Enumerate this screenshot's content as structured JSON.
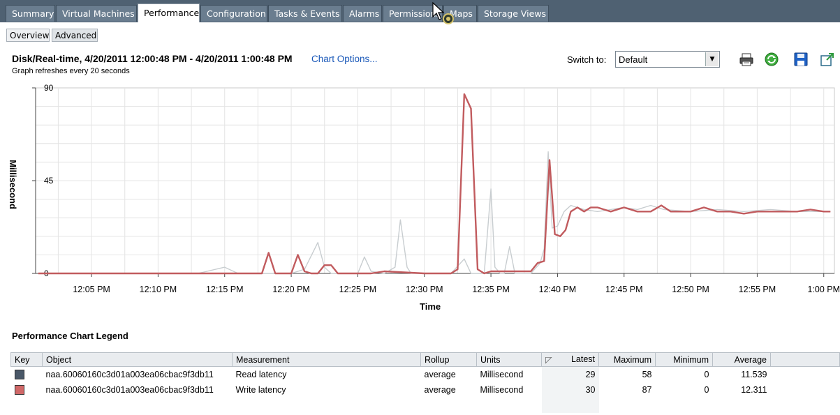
{
  "tabs": [
    {
      "label": "Summary",
      "active": false
    },
    {
      "label": "Virtual Machines",
      "active": false
    },
    {
      "label": "Performance",
      "active": true
    },
    {
      "label": "Configuration",
      "active": false
    },
    {
      "label": "Tasks & Events",
      "active": false
    },
    {
      "label": "Alarms",
      "active": false
    },
    {
      "label": "Permissions",
      "active": false
    },
    {
      "label": "Maps",
      "active": false
    },
    {
      "label": "Storage Views",
      "active": false
    }
  ],
  "subtabs": [
    {
      "label": "Overview",
      "active": false
    },
    {
      "label": "Advanced",
      "active": true
    }
  ],
  "header": {
    "title": "Disk/Real-time, 4/20/2011 12:00:48 PM - 4/20/2011 1:00:48 PM",
    "chart_options": "Chart Options...",
    "refresh_note": "Graph refreshes every 20 seconds",
    "switch_to_label": "Switch to:",
    "switch_to_value": "Default"
  },
  "toolbar": {
    "icons": [
      "print-icon",
      "refresh-icon",
      "save-icon",
      "popout-icon"
    ]
  },
  "colors": {
    "read": "#c8cdd0",
    "write": "#c15b5e",
    "read_swatch": "#4a5868",
    "write_swatch": "#d06868"
  },
  "chart_data": {
    "type": "line",
    "xlabel": "Time",
    "ylabel": "Millisecond",
    "ylim": [
      0,
      90
    ],
    "yticks": [
      0,
      45,
      90
    ],
    "xticks": [
      "12:05 PM",
      "12:10 PM",
      "12:15 PM",
      "12:20 PM",
      "12:25 PM",
      "12:30 PM",
      "12:35 PM",
      "12:40 PM",
      "12:45 PM",
      "12:50 PM",
      "12:55 PM",
      "1:00 PM"
    ],
    "xlim_minutes_after_noon": [
      0.8,
      60.8
    ],
    "grid": true,
    "series": [
      {
        "name": "Read latency",
        "points": [
          [
            1,
            0
          ],
          [
            10,
            0
          ],
          [
            13,
            0
          ],
          [
            15,
            3
          ],
          [
            16,
            0
          ],
          [
            20,
            0
          ],
          [
            21,
            2
          ],
          [
            22,
            15
          ],
          [
            22.5,
            3
          ],
          [
            23,
            0
          ],
          [
            25,
            0
          ],
          [
            25.5,
            8
          ],
          [
            26,
            1
          ],
          [
            27,
            0
          ],
          [
            27.8,
            3
          ],
          [
            28.2,
            26
          ],
          [
            28.7,
            3
          ],
          [
            29,
            0
          ],
          [
            32,
            0
          ],
          [
            33,
            7
          ],
          [
            33.5,
            0
          ],
          [
            34.5,
            0
          ],
          [
            35,
            41
          ],
          [
            35.3,
            3
          ],
          [
            35.7,
            0
          ],
          [
            36,
            0
          ],
          [
            36.4,
            13
          ],
          [
            36.8,
            0
          ],
          [
            38,
            0
          ],
          [
            38.7,
            5
          ],
          [
            39,
            12
          ],
          [
            39.3,
            59
          ],
          [
            39.6,
            22
          ],
          [
            40,
            23
          ],
          [
            40.5,
            30
          ],
          [
            41,
            33
          ],
          [
            42,
            31
          ],
          [
            43,
            30
          ],
          [
            44,
            31
          ],
          [
            45,
            32
          ],
          [
            46,
            31
          ],
          [
            47,
            33
          ],
          [
            48,
            31
          ],
          [
            50,
            30
          ],
          [
            52,
            31
          ],
          [
            54,
            30
          ],
          [
            56,
            31
          ],
          [
            58,
            30
          ],
          [
            60.5,
            30
          ]
        ]
      },
      {
        "name": "Write latency",
        "points": [
          [
            1,
            0
          ],
          [
            17,
            0
          ],
          [
            17.8,
            0
          ],
          [
            18.3,
            10
          ],
          [
            18.8,
            0
          ],
          [
            20,
            0
          ],
          [
            20.5,
            9
          ],
          [
            21,
            1
          ],
          [
            21.5,
            0
          ],
          [
            22,
            0
          ],
          [
            22.5,
            4
          ],
          [
            23,
            4
          ],
          [
            23.5,
            0
          ],
          [
            26,
            0
          ],
          [
            27,
            1
          ],
          [
            30,
            0
          ],
          [
            32,
            0
          ],
          [
            32.5,
            2
          ],
          [
            33,
            87
          ],
          [
            33.5,
            80
          ],
          [
            34,
            2
          ],
          [
            34.5,
            0
          ],
          [
            35,
            1
          ],
          [
            36,
            1
          ],
          [
            38,
            1
          ],
          [
            38.5,
            5
          ],
          [
            39,
            6
          ],
          [
            39.4,
            55
          ],
          [
            39.8,
            19
          ],
          [
            40.2,
            18
          ],
          [
            40.6,
            21
          ],
          [
            41,
            30
          ],
          [
            41.5,
            32
          ],
          [
            42,
            30
          ],
          [
            42.5,
            32
          ],
          [
            43,
            32
          ],
          [
            43.5,
            31
          ],
          [
            44,
            30
          ],
          [
            45,
            32
          ],
          [
            46,
            30
          ],
          [
            47,
            30
          ],
          [
            47.8,
            33
          ],
          [
            48.5,
            30
          ],
          [
            50,
            30
          ],
          [
            51,
            32
          ],
          [
            52,
            30
          ],
          [
            53,
            30
          ],
          [
            54,
            29
          ],
          [
            55,
            30
          ],
          [
            56,
            30
          ],
          [
            57,
            30
          ],
          [
            58,
            30
          ],
          [
            59,
            31
          ],
          [
            60,
            30
          ],
          [
            60.5,
            30
          ]
        ]
      }
    ]
  },
  "legend": {
    "title": "Performance Chart Legend",
    "columns": [
      "Key",
      "Object",
      "Measurement",
      "Rollup",
      "Units",
      "Latest",
      "Maximum",
      "Minimum",
      "Average"
    ],
    "rows": [
      {
        "object": "naa.60060160c3d01a003ea06cbac9f3db11",
        "measurement": "Read latency",
        "rollup": "average",
        "units": "Millisecond",
        "latest": "29",
        "maximum": "58",
        "minimum": "0",
        "average": "11.539"
      },
      {
        "object": "naa.60060160c3d01a003ea06cbac9f3db11",
        "measurement": "Write latency",
        "rollup": "average",
        "units": "Millisecond",
        "latest": "30",
        "maximum": "87",
        "minimum": "0",
        "average": "12.311"
      }
    ]
  }
}
